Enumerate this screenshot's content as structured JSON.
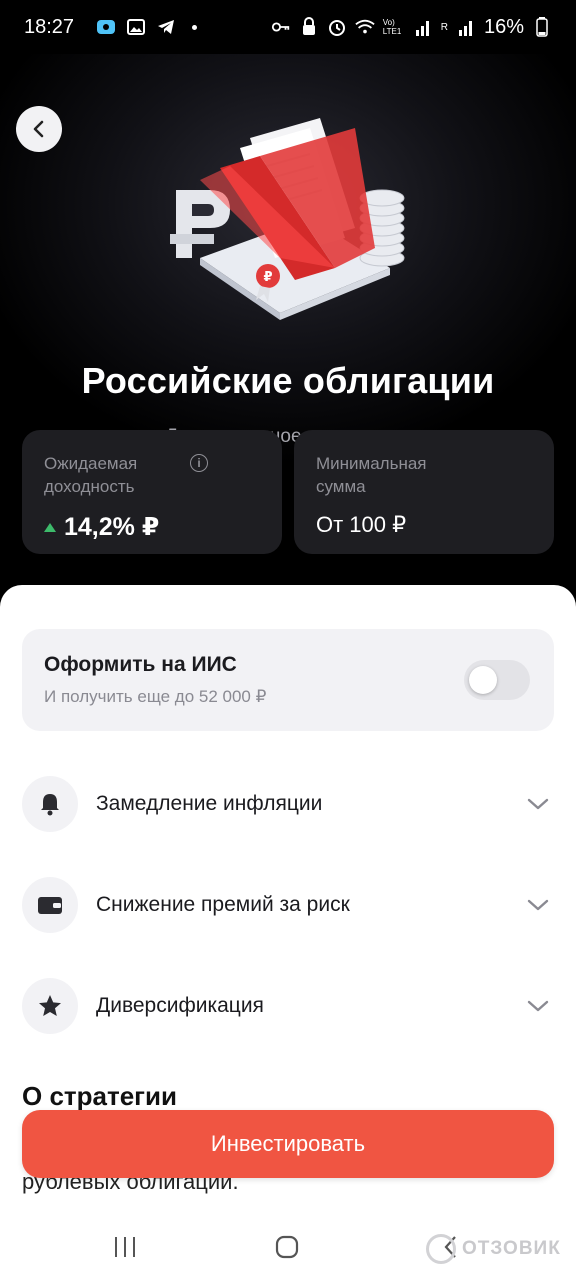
{
  "status_bar": {
    "time": "18:27",
    "battery": "16%",
    "network_label": "Vo) LTE1",
    "signal_r": "R"
  },
  "header": {
    "back_icon": "chevron-left-icon",
    "title": "Российские облигации",
    "subtitle": "Доверительное управление"
  },
  "stats": {
    "yield_label": "Ожидаемая доходность",
    "yield_value": "14,2% ₽",
    "min_label": "Минимальная сумма",
    "min_value": "От 100 ₽"
  },
  "iis": {
    "title": "Оформить на ИИС",
    "subtitle": "И получить еще до 52 000 ₽",
    "toggle_on": false
  },
  "accordion": [
    {
      "icon": "bell-icon",
      "label": "Замедление инфляции"
    },
    {
      "icon": "wallet-icon",
      "label": "Снижение премий за риск"
    },
    {
      "icon": "star-icon",
      "label": "Диверсификация"
    }
  ],
  "strategy": {
    "title": "О стратегии",
    "text_fragment": "рублевых облигаций."
  },
  "cta": {
    "label": "Инвестировать"
  },
  "watermark": "ОТЗОВИК",
  "colors": {
    "accent": "#f05542",
    "up": "#3dbb6b",
    "card_dark": "#1e1e22",
    "card_light": "#f2f2f5"
  }
}
